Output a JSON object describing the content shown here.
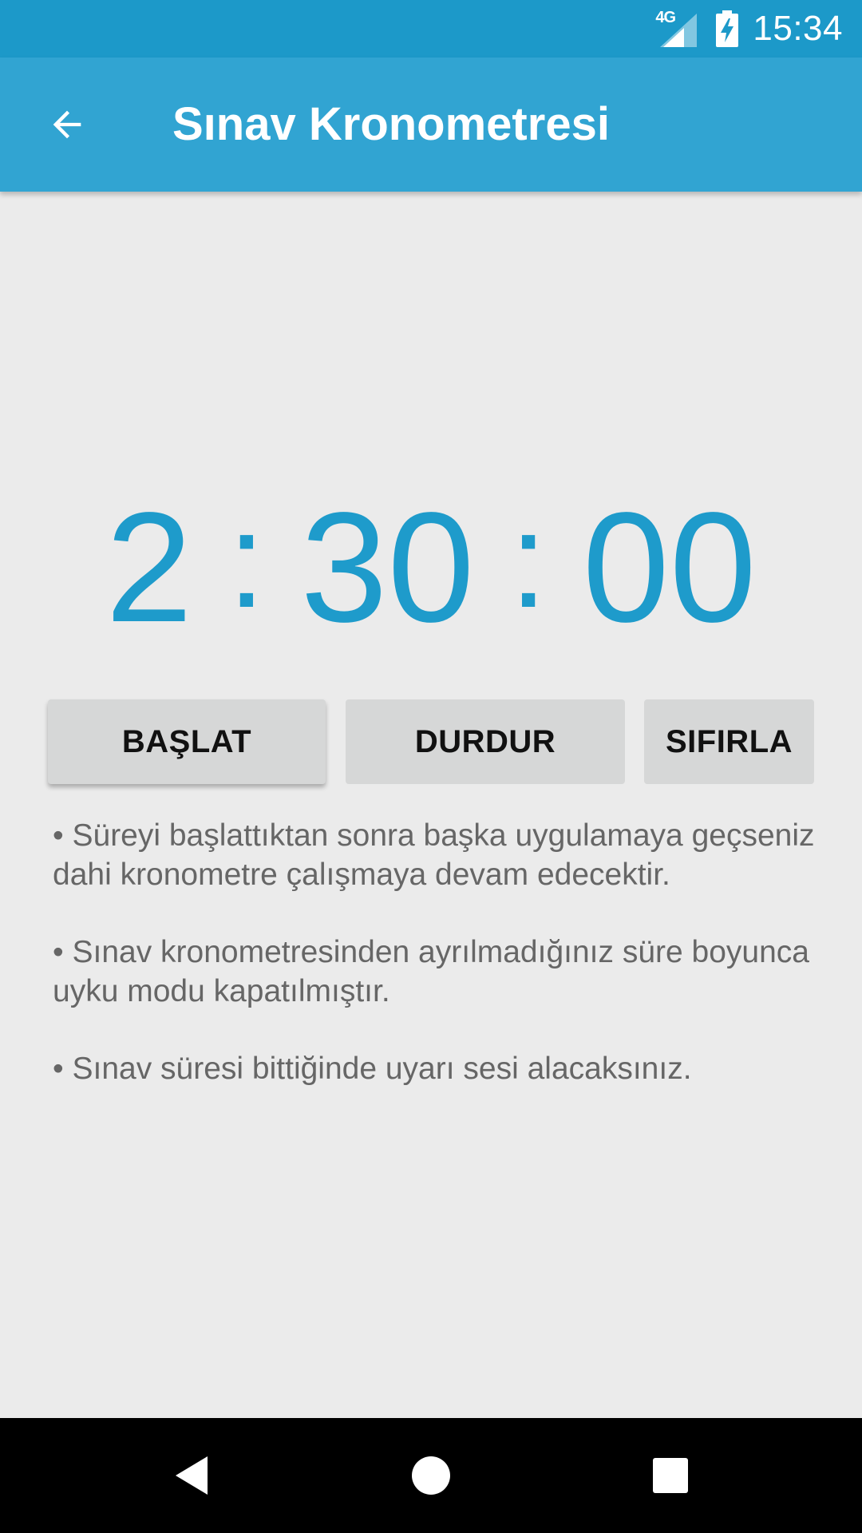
{
  "status_bar": {
    "network_type": "4G",
    "time": "15:34",
    "icons": [
      "signal-icon",
      "battery-charging-icon"
    ]
  },
  "app_bar": {
    "title": "Sınav Kronometresi",
    "back_icon": "arrow-back-icon"
  },
  "timer": {
    "hours": "2",
    "minutes": "30",
    "seconds": "00",
    "separator": ":"
  },
  "buttons": {
    "start_label": "BAŞLAT",
    "stop_label": "DURDUR",
    "reset_label": "SIFIRLA"
  },
  "notes": [
    "• Süreyi başlattıktan sonra başka uygulamaya geçseniz dahi kronometre çalışmaya devam edecektir.",
    "• Sınav kronometresinden ayrılmadığınız süre boyunca uyku modu kapatılmıştır.",
    "• Sınav süresi bittiğinde uyarı sesi alacaksınız."
  ],
  "nav_bar": {
    "icons": [
      "nav-back-icon",
      "nav-home-icon",
      "nav-recents-icon"
    ]
  },
  "colors": {
    "status_bar": "#1c99c9",
    "app_bar": "#31a4d2",
    "timer_text": "#1e9bcb",
    "background": "#ebebeb",
    "button": "#d6d7d7",
    "note_text": "#666666"
  }
}
